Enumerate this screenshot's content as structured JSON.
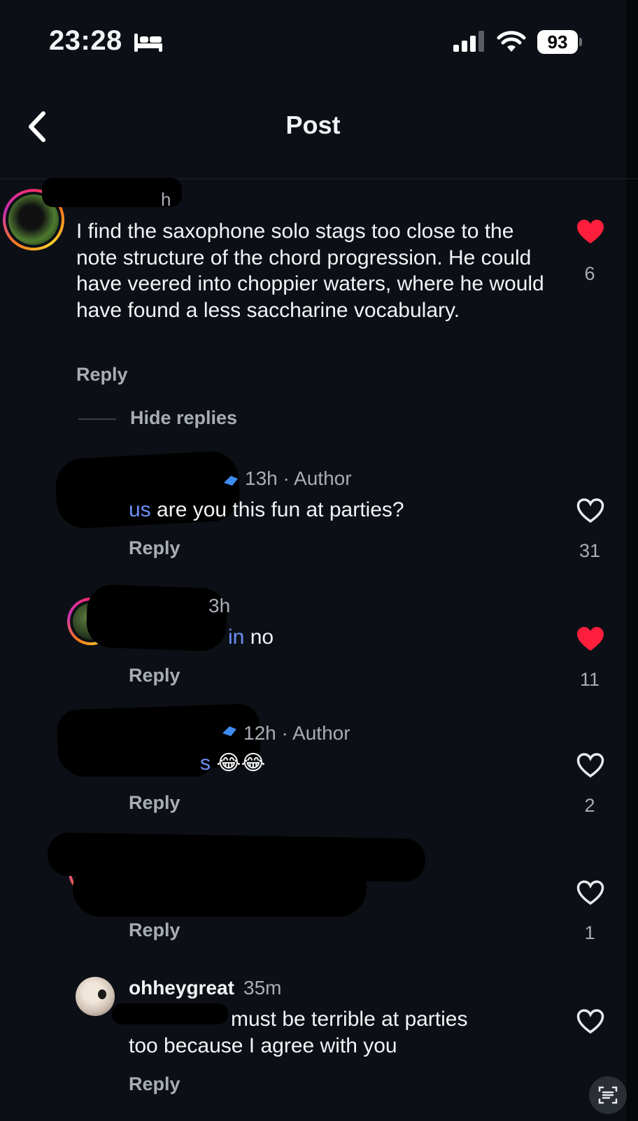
{
  "status": {
    "time": "23:28",
    "battery": "93"
  },
  "header": {
    "title": "Post"
  },
  "main_comment": {
    "username": "",
    "time": "h",
    "text": "I find the saxophone solo stags too close to the note structure of the chord progression. He could have veered into choppier waters, where he would have found a less saccharine vocabulary.",
    "reply_label": "Reply",
    "likes": "6",
    "liked": true,
    "hide_replies_label": "Hide replies"
  },
  "replies": [
    {
      "time": "13h",
      "author_badge": "· Author",
      "mention": "us",
      "text": " are you this fun at parties?",
      "reply_label": "Reply",
      "likes": "31",
      "liked": false
    },
    {
      "time": "3h",
      "mention": "in",
      "text": " no",
      "reply_label": "Reply",
      "likes": "11",
      "liked": true
    },
    {
      "time": "12h",
      "author_badge": "· Author",
      "mention": "s",
      "text": " 😂😂",
      "reply_label": "Reply",
      "likes": "2",
      "liked": false
    },
    {
      "reply_label": "Reply",
      "likes": "1",
      "liked": false
    },
    {
      "username": "ohheygreat",
      "time": "35m",
      "text_line1": "must be terrible at parties",
      "text_line2": "too because I agree with you",
      "reply_label": "Reply",
      "liked": false
    }
  ],
  "colors": {
    "background": "#0c1016",
    "mention": "#6d8ff7",
    "heart": "#ff1e3c",
    "muted": "#a8adb5"
  },
  "icons": [
    "back-chevron-icon",
    "bed-icon",
    "cellular-icon",
    "wifi-icon",
    "battery-icon",
    "heart-icon",
    "text-scan-icon"
  ]
}
